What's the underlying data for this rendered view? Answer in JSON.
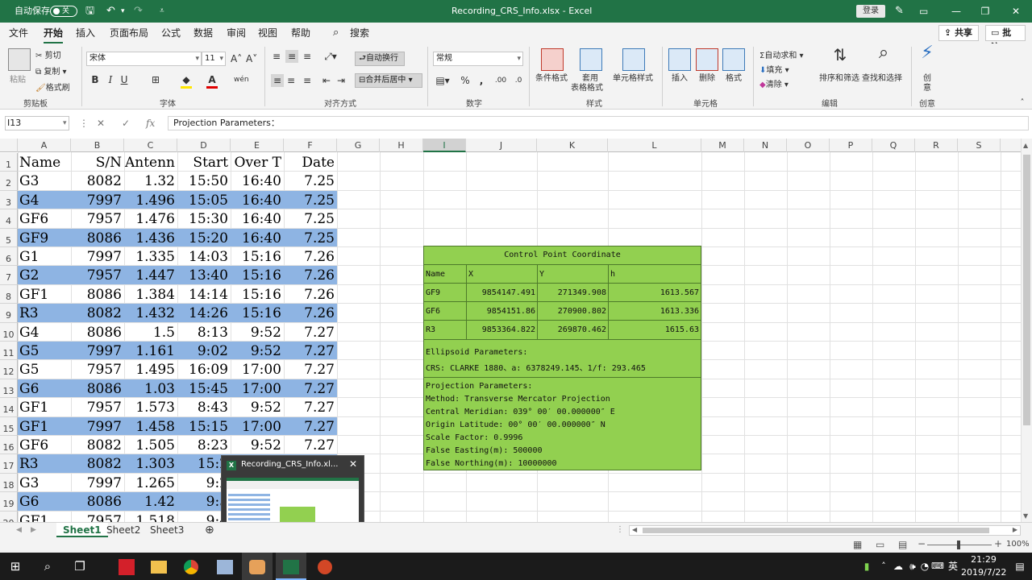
{
  "titlebar": {
    "autosave_label": "自动保存",
    "autosave_state": "关",
    "title": "Recording_CRS_Info.xlsx - Excel",
    "login": "登录",
    "minimize": "—",
    "restore": "❐",
    "close": "✕"
  },
  "tabs": [
    "文件",
    "开始",
    "插入",
    "页面布局",
    "公式",
    "数据",
    "审阅",
    "视图",
    "帮助"
  ],
  "search_label": "搜索",
  "share_label": "共享",
  "comment_label": "批注",
  "ribbon": {
    "paste": "粘贴",
    "cut": "剪切",
    "copy": "复制",
    "format_painter": "格式刷",
    "clipboard_group": "剪贴板",
    "font_name": "宋体",
    "font_size": "11",
    "font_group": "字体",
    "wrap": "自动换行",
    "merge": "合并后居中",
    "align_group": "对齐方式",
    "number_format": "常规",
    "number_group": "数字",
    "cond_format": "条件格式",
    "table_format_1": "套用",
    "table_format_2": "表格格式",
    "cell_style": "单元格样式",
    "styles_group": "样式",
    "insert": "插入",
    "delete": "删除",
    "format": "格式",
    "cells_group": "单元格",
    "autosum": "自动求和",
    "fill": "填充",
    "clear": "清除",
    "sort": "排序和筛选",
    "find": "查找和选择",
    "edit_group": "编辑",
    "create_1": "创",
    "create_2": "意",
    "create_group": "创意"
  },
  "namebox": "I13",
  "formula": "Projection Parameters：",
  "columns": [
    "A",
    "B",
    "C",
    "D",
    "E",
    "F",
    "G",
    "H",
    "I",
    "J",
    "K",
    "L",
    "M",
    "N",
    "O",
    "P",
    "Q",
    "R",
    "S"
  ],
  "rows": [
    {
      "n": "1",
      "a": "Name",
      "b": "S/N",
      "c": "Antenn",
      "d": "Start",
      "e": "Over T",
      "f": "Date"
    },
    {
      "n": "2",
      "a": "G3",
      "b": "8082",
      "c": "1.32",
      "d": "15:50",
      "e": "16:40",
      "f": "7.25"
    },
    {
      "n": "3",
      "a": "G4",
      "b": "7997",
      "c": "1.496",
      "d": "15:05",
      "e": "16:40",
      "f": "7.25"
    },
    {
      "n": "4",
      "a": "GF6",
      "b": "7957",
      "c": "1.476",
      "d": "15:30",
      "e": "16:40",
      "f": "7.25"
    },
    {
      "n": "5",
      "a": "GF9",
      "b": "8086",
      "c": "1.436",
      "d": "15:20",
      "e": "16:40",
      "f": "7.25"
    },
    {
      "n": "6",
      "a": "G1",
      "b": "7997",
      "c": "1.335",
      "d": "14:03",
      "e": "15:16",
      "f": "7.26"
    },
    {
      "n": "7",
      "a": "G2",
      "b": "7957",
      "c": "1.447",
      "d": "13:40",
      "e": "15:16",
      "f": "7.26"
    },
    {
      "n": "8",
      "a": "GF1",
      "b": "8086",
      "c": "1.384",
      "d": "14:14",
      "e": "15:16",
      "f": "7.26"
    },
    {
      "n": "9",
      "a": "R3",
      "b": "8082",
      "c": "1.432",
      "d": "14:26",
      "e": "15:16",
      "f": "7.26"
    },
    {
      "n": "10",
      "a": "G4",
      "b": "8086",
      "c": "1.5",
      "d": "8:13",
      "e": "9:52",
      "f": "7.27"
    },
    {
      "n": "11",
      "a": "G5",
      "b": "7997",
      "c": "1.161",
      "d": "9:02",
      "e": "9:52",
      "f": "7.27"
    },
    {
      "n": "12",
      "a": "G5",
      "b": "7957",
      "c": "1.495",
      "d": "16:09",
      "e": "17:00",
      "f": "7.27"
    },
    {
      "n": "13",
      "a": "G6",
      "b": "8086",
      "c": "1.03",
      "d": "15:45",
      "e": "17:00",
      "f": "7.27"
    },
    {
      "n": "14",
      "a": "GF1",
      "b": "7957",
      "c": "1.573",
      "d": "8:43",
      "e": "9:52",
      "f": "7.27"
    },
    {
      "n": "15",
      "a": "GF1",
      "b": "7997",
      "c": "1.458",
      "d": "15:15",
      "e": "17:00",
      "f": "7.27"
    },
    {
      "n": "16",
      "a": "GF6",
      "b": "8082",
      "c": "1.505",
      "d": "8:23",
      "e": "9:52",
      "f": "7.27"
    },
    {
      "n": "17",
      "a": "R3",
      "b": "8082",
      "c": "1.303",
      "d": "15:2",
      "e": "",
      "f": ""
    },
    {
      "n": "18",
      "a": "G3",
      "b": "7997",
      "c": "1.265",
      "d": "9:2",
      "e": "",
      "f": ""
    },
    {
      "n": "19",
      "a": "G6",
      "b": "8086",
      "c": "1.42",
      "d": "9:5",
      "e": "",
      "f": ""
    },
    {
      "n": "20",
      "a": "GF1",
      "b": "7957",
      "c": "1.518",
      "d": "9:4",
      "e": "",
      "f": ""
    }
  ],
  "control": {
    "title": "Control Point Coordinate",
    "headers": [
      "Name",
      "X",
      "Y",
      "h"
    ],
    "points": [
      {
        "name": "GF9",
        "x": "9854147.491",
        "y": "271349.908",
        "h": "1613.567"
      },
      {
        "name": "GF6",
        "x": "9854151.86",
        "y": "270900.802",
        "h": "1613.336"
      },
      {
        "name": "R3",
        "x": "9853364.822",
        "y": "269870.462",
        "h": "1615.63"
      }
    ],
    "ellipsoid_title": "Ellipsoid Parameters:",
    "ellipsoid_value": "CRS: CLARKE 1880、a: 6378249.145、1/f: 293.465",
    "projection_lines": [
      "Projection Parameters:",
      "Method: Transverse Mercator Projection",
      "Central Meridian: 039° 00′ 00.000000″ E",
      "Origin Latitude: 00° 00′ 00.000000″ N",
      "Scale Factor: 0.9996",
      "False Easting(m): 500000",
      "False Northing(m): 10000000"
    ]
  },
  "sheets": [
    "Sheet1",
    "Sheet2",
    "Sheet3"
  ],
  "zoom": "100%",
  "thumbnail_title": "Recording_CRS_Info.xl...",
  "clock": {
    "time": "21:29",
    "date": "2019/7/22"
  },
  "tray_icon_text": "英"
}
